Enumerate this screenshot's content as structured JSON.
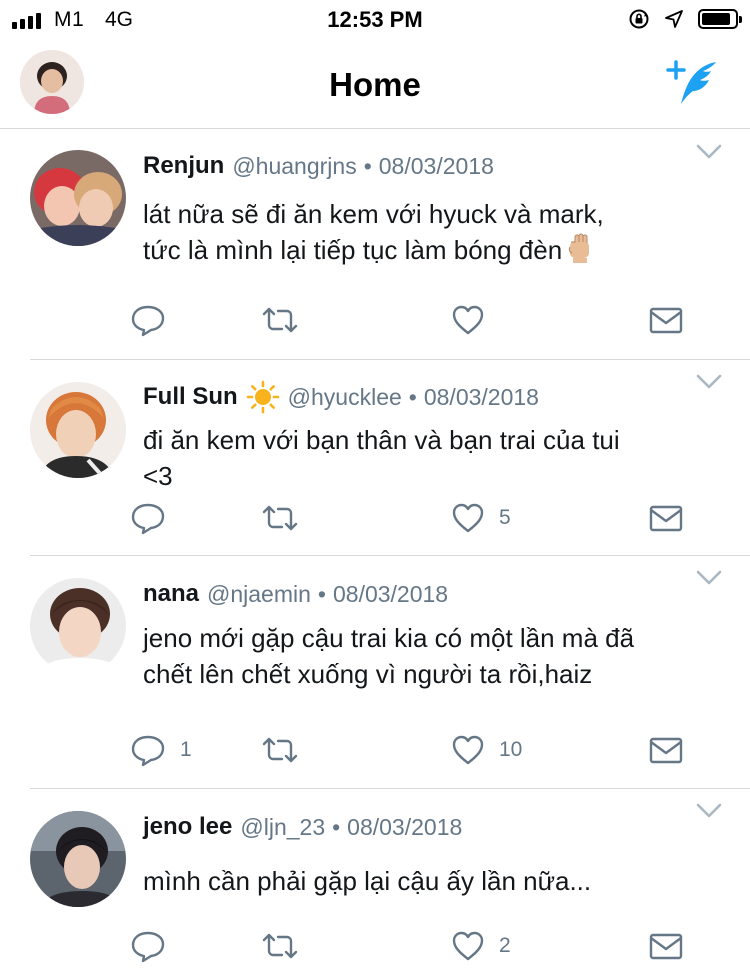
{
  "status_bar": {
    "carrier": "M1",
    "network": "4G",
    "time": "12:53 PM"
  },
  "nav": {
    "title": "Home"
  },
  "colors": {
    "accent": "#1da1f2",
    "icon_gray": "#657786",
    "text": "#14171a",
    "divider": "#d6d9db"
  },
  "icons": {
    "reply": "reply-icon",
    "retweet": "retweet-icon",
    "like": "heart-icon",
    "dm": "envelope-icon",
    "menu": "chevron-down-icon",
    "compose": "compose-tweet-icon"
  },
  "tweets": [
    {
      "name": "Renjun",
      "handle": "@huangrjns",
      "separator": "•",
      "date": "08/03/2018",
      "lines": [
        "lát nữa sẽ đi ăn kem với hyuck và mark,",
        "tức là mình lại tiếp tục làm bóng đèn"
      ],
      "reply_count": "",
      "like_count": ""
    },
    {
      "name": "Full Sun",
      "handle": "@hyucklee",
      "separator": "•",
      "date": "08/03/2018",
      "lines": [
        "đi ăn kem với bạn thân và bạn trai của tui",
        "<3"
      ],
      "reply_count": "",
      "like_count": "5"
    },
    {
      "name": "nana",
      "handle": "@njaemin",
      "separator": "•",
      "date": "08/03/2018",
      "lines": [
        "jeno mới gặp cậu trai kia có một lần mà đã",
        "chết lên chết xuống vì người ta rồi,haiz"
      ],
      "reply_count": "1",
      "like_count": "10"
    },
    {
      "name": "jeno lee",
      "handle": "@ljn_23",
      "separator": "•",
      "date": "08/03/2018",
      "lines": [
        "mình cần phải gặp lại cậu ấy lần nữa..."
      ],
      "reply_count": "",
      "like_count": "2"
    }
  ]
}
